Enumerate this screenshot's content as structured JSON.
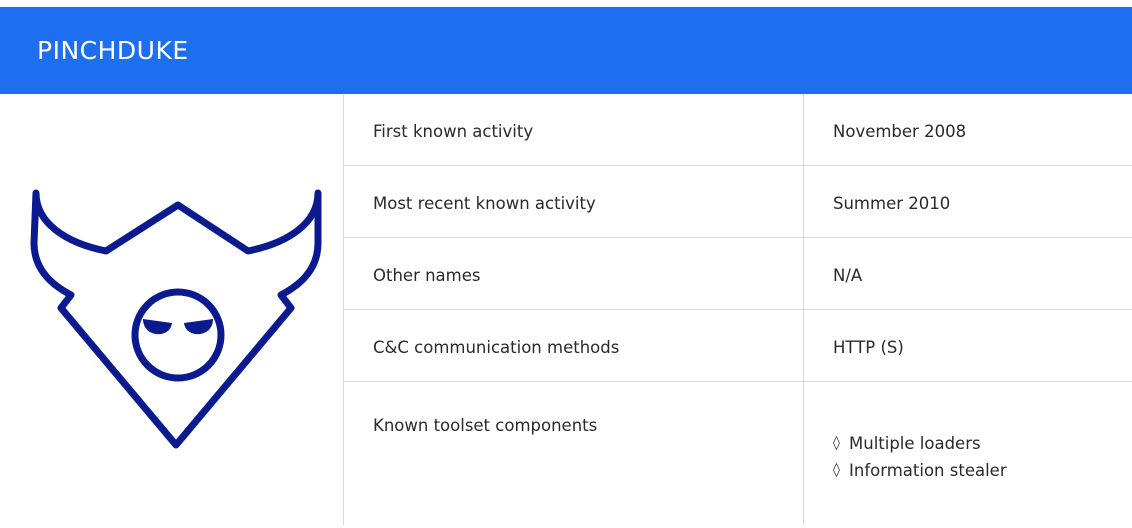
{
  "header": {
    "title": "PINCHDUKE",
    "background_color": "#1e6ff0"
  },
  "logo": {
    "icon": "devil-shield-face-icon",
    "color": "#0b1b8f"
  },
  "table": {
    "rows": [
      {
        "label": "First known activity",
        "value": "November 2008"
      },
      {
        "label": "Most recent known activity",
        "value": "Summer 2010"
      },
      {
        "label": "Other names",
        "value": "N/A"
      },
      {
        "label": "C&C communication methods",
        "value": "HTTP (S)"
      }
    ],
    "components": {
      "label": "Known toolset components",
      "bullet": "◊",
      "items": [
        "Multiple loaders",
        "Information stealer"
      ]
    }
  }
}
